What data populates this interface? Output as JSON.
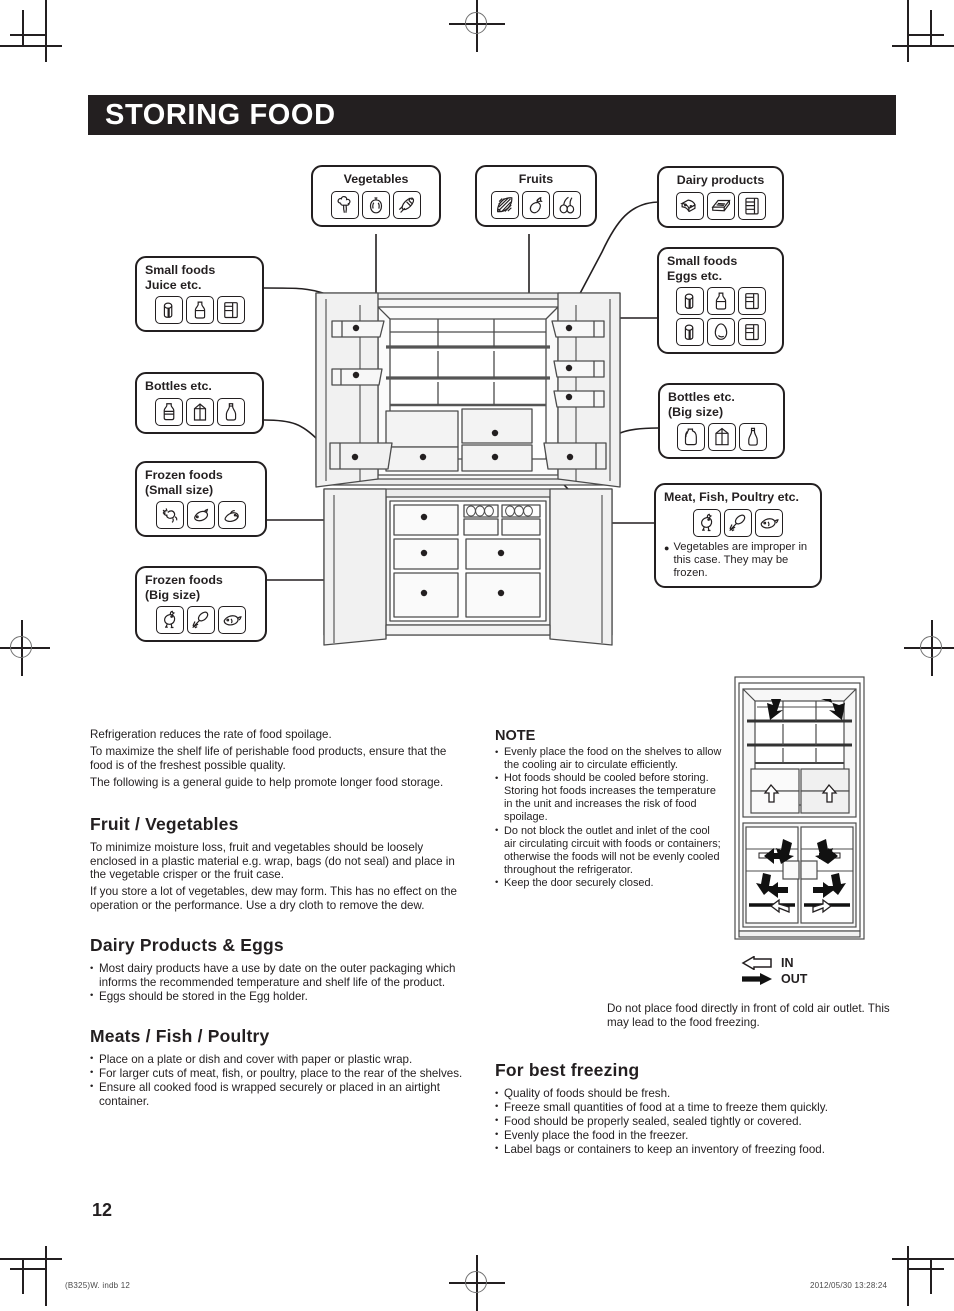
{
  "page": {
    "title": "STORING FOOD",
    "number": "12",
    "footer_left": "(B325)W. indb   12",
    "footer_right": "2012/05/30   13:28:24"
  },
  "diagram": {
    "labels": [
      {
        "key": "vegetables",
        "title": "Vegetables",
        "icons": [
          "broccoli-icon",
          "bell-pepper-icon",
          "corn-icon"
        ]
      },
      {
        "key": "fruits",
        "title": "Fruits",
        "icons": [
          "orange-slice-icon",
          "strawberry-icon",
          "cherry-icon"
        ]
      },
      {
        "key": "dairy",
        "title": "Dairy products",
        "icons": [
          "cheese-icon",
          "butter-pack-icon",
          "yogurt-jar-icon"
        ]
      },
      {
        "key": "small_foods_juice",
        "title": "Small foods\nJuice etc.",
        "icons": [
          "juice-carton-icon",
          "juice-bottle-icon",
          "jar-icon"
        ]
      },
      {
        "key": "small_foods_eggs",
        "title": "Small foods\nEggs etc.",
        "icons": [
          "juice-carton-icon",
          "juice-bottle-icon",
          "jar-icon",
          "juice-carton-icon",
          "egg-icon",
          "jar-icon"
        ]
      },
      {
        "key": "bottles",
        "title": "Bottles etc.",
        "icons": [
          "plastic-bottle-icon",
          "milk-carton-icon",
          "glass-bottle-icon"
        ]
      },
      {
        "key": "bottles_big",
        "title": "Bottles etc.\n(Big size)",
        "icons": [
          "big-jug-icon",
          "big-milk-carton-icon",
          "big-glass-bottle-icon"
        ]
      },
      {
        "key": "frozen_small",
        "title": "Frozen foods\n(Small size)",
        "icons": [
          "meat-cut-icon",
          "fish-fillet-icon",
          "shrimp-icon"
        ]
      },
      {
        "key": "frozen_big",
        "title": "Frozen foods\n(Big size)",
        "icons": [
          "whole-chicken-icon",
          "chicken-leg-icon",
          "whole-fish-icon"
        ]
      },
      {
        "key": "meat_fish",
        "title": "Meat, Fish, Poultry etc.",
        "icons": [
          "whole-chicken-icon",
          "chicken-leg-icon",
          "whole-fish-icon"
        ],
        "note": "Vegetables are improper in this case. They may be frozen."
      }
    ]
  },
  "intro": {
    "lines": [
      "Refrigeration reduces the rate of food spoilage.",
      "To maximize the shelf life of perishable food products, ensure that the food is of the freshest possible quality.",
      "The following is a general guide to help promote longer food storage."
    ]
  },
  "sections": [
    {
      "heading": "Fruit / Vegetables",
      "paragraphs": [
        "To minimize moisture loss, fruit and vegetables should be loosely enclosed in a plastic material e.g. wrap, bags (do not seal) and place in the vegetable crisper or the fruit case.",
        "If you store a lot of vegetables, dew may form. This has no effect on the operation or the performance. Use a dry cloth to remove the dew."
      ],
      "bullets": []
    },
    {
      "heading": "Dairy Products & Eggs",
      "paragraphs": [],
      "bullets": [
        "Most dairy products have a use by date on the outer packaging which informs the recommended temperature and shelf life of the product.",
        "Eggs should be stored in the Egg holder."
      ]
    },
    {
      "heading": "Meats / Fish / Poultry",
      "paragraphs": [],
      "bullets": [
        "Place on a plate or dish and cover with paper or plastic wrap.",
        "For larger cuts of meat, fish, or poultry, place to the rear of the shelves.",
        "Ensure all cooked food is wrapped securely or placed in an airtight container."
      ]
    }
  ],
  "note": {
    "heading": "NOTE",
    "bullets": [
      "Evenly place the food on the shelves to allow the cooling air to circulate efficiently.",
      "Hot foods should be cooled before storing. Storing hot foods increases the temperature in the unit and increases the risk of food spoilage.",
      "Do not block the outlet and inlet of the cool air circulating circuit with foods or containers; otherwise the foods will not be evenly cooled throughout the refrigerator.",
      "Keep the door securely closed."
    ]
  },
  "airflow": {
    "legend": [
      {
        "key": "in",
        "label": "IN",
        "arrow": "hollow-arrow-left-icon"
      },
      {
        "key": "out",
        "label": "OUT",
        "arrow": "solid-arrow-right-icon"
      }
    ],
    "caption": "Do not place food directly in front of cold air outlet. This may lead to the food freezing."
  },
  "freezing": {
    "heading": "For best freezing",
    "bullets": [
      "Quality of foods should be fresh.",
      "Freeze small quantities of food at a time to freeze them quickly.",
      "Food should be properly sealed, sealed tightly or covered.",
      "Evenly place the food in the freezer.",
      "Label bags or containers to keep an inventory of freezing food."
    ]
  },
  "colors": {
    "ink": "#231f20",
    "paper": "#ffffff",
    "panel_fill": "#f2f2f2"
  }
}
